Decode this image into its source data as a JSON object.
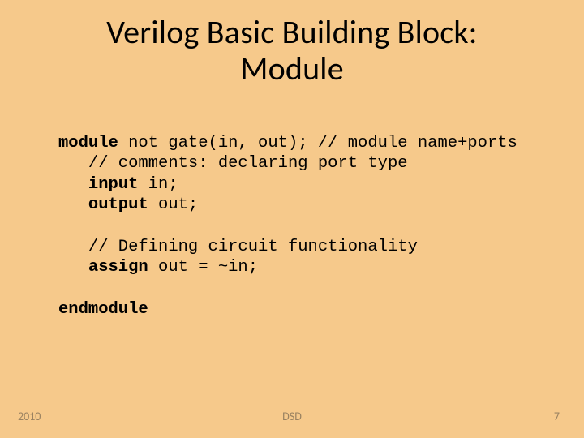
{
  "title": {
    "line1": "Verilog Basic Building Block:",
    "line2": "Module"
  },
  "code": {
    "l1_kw": "module",
    "l1_rest": " not_gate(in, out); // module name+ports",
    "l2": "   // comments: declaring port type",
    "l3_kw": "   input",
    "l3_rest": " in;",
    "l4_kw": "   output",
    "l4_rest": " out;",
    "l5": "",
    "l6": "   // Defining circuit functionality",
    "l7_kw": "   assign",
    "l7_rest": " out = ~in;",
    "l8": "",
    "l9_kw": "endmodule"
  },
  "footer": {
    "year": "2010",
    "mid": "DSD",
    "page": "7"
  }
}
